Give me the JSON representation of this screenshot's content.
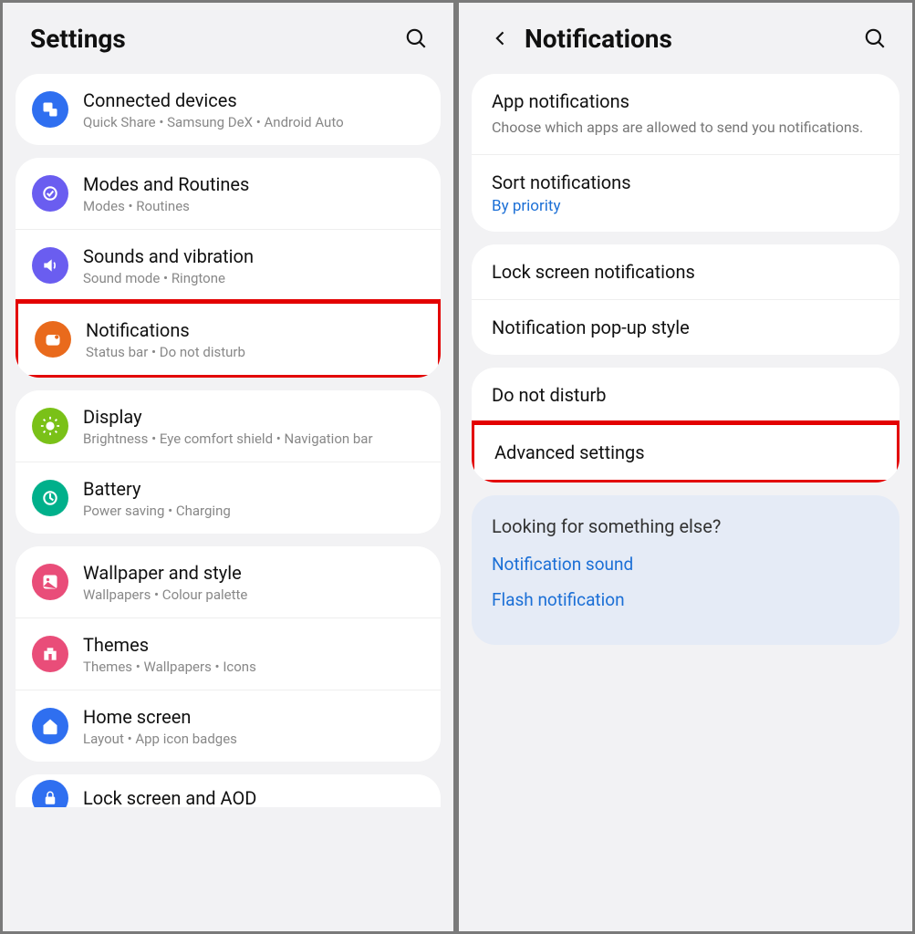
{
  "left": {
    "header": {
      "title": "Settings"
    },
    "groups": [
      {
        "items": [
          {
            "icon": "connected-devices-icon",
            "color": "#2f6ff0",
            "title": "Connected devices",
            "sub": "Quick Share  •  Samsung DeX  •  Android Auto"
          }
        ]
      },
      {
        "items": [
          {
            "icon": "modes-routines-icon",
            "color": "#6a5df0",
            "title": "Modes and Routines",
            "sub": "Modes  •  Routines"
          },
          {
            "icon": "sounds-icon",
            "color": "#6a5df0",
            "title": "Sounds and vibration",
            "sub": "Sound mode  •  Ringtone"
          },
          {
            "icon": "notifications-icon",
            "color": "#e96a1c",
            "title": "Notifications",
            "sub": "Status bar  •  Do not disturb",
            "highlighted": true
          }
        ]
      },
      {
        "items": [
          {
            "icon": "display-icon",
            "color": "#7ac118",
            "title": "Display",
            "sub": "Brightness  •  Eye comfort shield  •  Navigation bar"
          },
          {
            "icon": "battery-icon",
            "color": "#00b08b",
            "title": "Battery",
            "sub": "Power saving  •  Charging"
          }
        ]
      },
      {
        "items": [
          {
            "icon": "wallpaper-icon",
            "color": "#e94d79",
            "title": "Wallpaper and style",
            "sub": "Wallpapers  •  Colour palette"
          },
          {
            "icon": "themes-icon",
            "color": "#e94d79",
            "title": "Themes",
            "sub": "Themes  •  Wallpapers  •  Icons"
          },
          {
            "icon": "home-screen-icon",
            "color": "#2f6ff0",
            "title": "Home screen",
            "sub": "Layout  •  App icon badges"
          }
        ]
      }
    ],
    "partial": {
      "icon": "lock-screen-icon",
      "color": "#2f6ff0",
      "title": "Lock screen and AOD"
    }
  },
  "right": {
    "header": {
      "title": "Notifications"
    },
    "groups": [
      {
        "items": [
          {
            "title": "App notifications",
            "sub": "Choose which apps are allowed to send you notifications."
          },
          {
            "title": "Sort notifications",
            "link": "By priority"
          }
        ]
      },
      {
        "items": [
          {
            "title": "Lock screen notifications"
          },
          {
            "title": "Notification pop-up style"
          }
        ]
      },
      {
        "items": [
          {
            "title": "Do not disturb"
          },
          {
            "title": "Advanced settings",
            "highlighted": true
          }
        ]
      }
    ],
    "lfse": {
      "title": "Looking for something else?",
      "links": [
        "Notification sound",
        "Flash notification"
      ]
    }
  }
}
